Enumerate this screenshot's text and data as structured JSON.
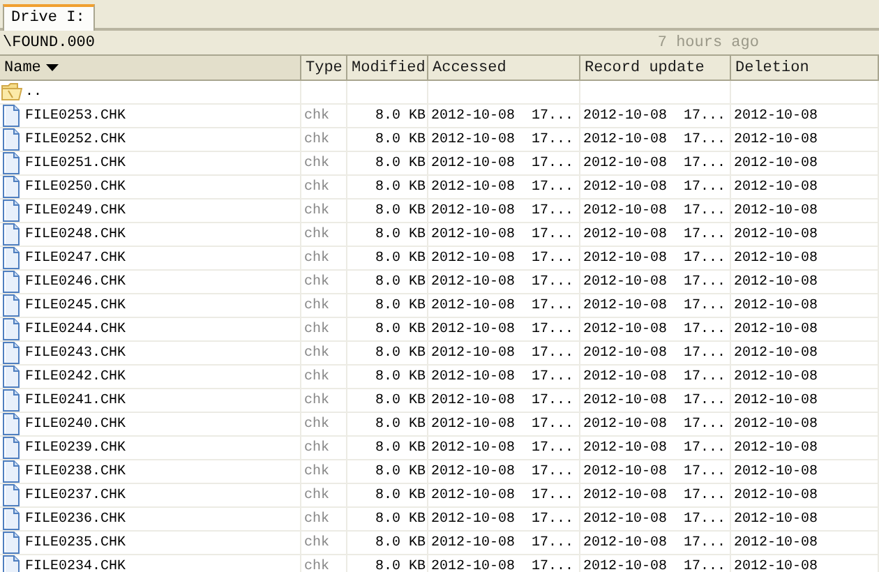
{
  "tabs": [
    {
      "label": "Drive I:",
      "selected": true
    }
  ],
  "path_bar": {
    "path": "\\FOUND.000",
    "updated": "7 hours ago"
  },
  "table": {
    "columns": [
      {
        "label": "Name",
        "sorted": true
      },
      {
        "label": "Type",
        "sorted": false
      },
      {
        "label": "Modified",
        "sorted": false
      },
      {
        "label": "Accessed",
        "sorted": false
      },
      {
        "label": "Record update",
        "sorted": false
      },
      {
        "label": "Deletion",
        "sorted": false
      }
    ],
    "rows": [
      {
        "kind": "parent",
        "name": ".."
      },
      {
        "kind": "file",
        "name": "FILE0253.CHK",
        "type": "chk",
        "modified": "8.0 KB",
        "accessed": "2012-10-08  17...",
        "record_update": "2012-10-08  17...",
        "deletion": "2012-10-08"
      },
      {
        "kind": "file",
        "name": "FILE0252.CHK",
        "type": "chk",
        "modified": "8.0 KB",
        "accessed": "2012-10-08  17...",
        "record_update": "2012-10-08  17...",
        "deletion": "2012-10-08"
      },
      {
        "kind": "file",
        "name": "FILE0251.CHK",
        "type": "chk",
        "modified": "8.0 KB",
        "accessed": "2012-10-08  17...",
        "record_update": "2012-10-08  17...",
        "deletion": "2012-10-08"
      },
      {
        "kind": "file",
        "name": "FILE0250.CHK",
        "type": "chk",
        "modified": "8.0 KB",
        "accessed": "2012-10-08  17...",
        "record_update": "2012-10-08  17...",
        "deletion": "2012-10-08"
      },
      {
        "kind": "file",
        "name": "FILE0249.CHK",
        "type": "chk",
        "modified": "8.0 KB",
        "accessed": "2012-10-08  17...",
        "record_update": "2012-10-08  17...",
        "deletion": "2012-10-08"
      },
      {
        "kind": "file",
        "name": "FILE0248.CHK",
        "type": "chk",
        "modified": "8.0 KB",
        "accessed": "2012-10-08  17...",
        "record_update": "2012-10-08  17...",
        "deletion": "2012-10-08"
      },
      {
        "kind": "file",
        "name": "FILE0247.CHK",
        "type": "chk",
        "modified": "8.0 KB",
        "accessed": "2012-10-08  17...",
        "record_update": "2012-10-08  17...",
        "deletion": "2012-10-08"
      },
      {
        "kind": "file",
        "name": "FILE0246.CHK",
        "type": "chk",
        "modified": "8.0 KB",
        "accessed": "2012-10-08  17...",
        "record_update": "2012-10-08  17...",
        "deletion": "2012-10-08"
      },
      {
        "kind": "file",
        "name": "FILE0245.CHK",
        "type": "chk",
        "modified": "8.0 KB",
        "accessed": "2012-10-08  17...",
        "record_update": "2012-10-08  17...",
        "deletion": "2012-10-08"
      },
      {
        "kind": "file",
        "name": "FILE0244.CHK",
        "type": "chk",
        "modified": "8.0 KB",
        "accessed": "2012-10-08  17...",
        "record_update": "2012-10-08  17...",
        "deletion": "2012-10-08"
      },
      {
        "kind": "file",
        "name": "FILE0243.CHK",
        "type": "chk",
        "modified": "8.0 KB",
        "accessed": "2012-10-08  17...",
        "record_update": "2012-10-08  17...",
        "deletion": "2012-10-08"
      },
      {
        "kind": "file",
        "name": "FILE0242.CHK",
        "type": "chk",
        "modified": "8.0 KB",
        "accessed": "2012-10-08  17...",
        "record_update": "2012-10-08  17...",
        "deletion": "2012-10-08"
      },
      {
        "kind": "file",
        "name": "FILE0241.CHK",
        "type": "chk",
        "modified": "8.0 KB",
        "accessed": "2012-10-08  17...",
        "record_update": "2012-10-08  17...",
        "deletion": "2012-10-08"
      },
      {
        "kind": "file",
        "name": "FILE0240.CHK",
        "type": "chk",
        "modified": "8.0 KB",
        "accessed": "2012-10-08  17...",
        "record_update": "2012-10-08  17...",
        "deletion": "2012-10-08"
      },
      {
        "kind": "file",
        "name": "FILE0239.CHK",
        "type": "chk",
        "modified": "8.0 KB",
        "accessed": "2012-10-08  17...",
        "record_update": "2012-10-08  17...",
        "deletion": "2012-10-08"
      },
      {
        "kind": "file",
        "name": "FILE0238.CHK",
        "type": "chk",
        "modified": "8.0 KB",
        "accessed": "2012-10-08  17...",
        "record_update": "2012-10-08  17...",
        "deletion": "2012-10-08"
      },
      {
        "kind": "file",
        "name": "FILE0237.CHK",
        "type": "chk",
        "modified": "8.0 KB",
        "accessed": "2012-10-08  17...",
        "record_update": "2012-10-08  17...",
        "deletion": "2012-10-08"
      },
      {
        "kind": "file",
        "name": "FILE0236.CHK",
        "type": "chk",
        "modified": "8.0 KB",
        "accessed": "2012-10-08  17...",
        "record_update": "2012-10-08  17...",
        "deletion": "2012-10-08"
      },
      {
        "kind": "file",
        "name": "FILE0235.CHK",
        "type": "chk",
        "modified": "8.0 KB",
        "accessed": "2012-10-08  17...",
        "record_update": "2012-10-08  17...",
        "deletion": "2012-10-08"
      },
      {
        "kind": "file",
        "name": "FILE0234.CHK",
        "type": "chk",
        "modified": "8.0 KB",
        "accessed": "2012-10-08  17...",
        "record_update": "2012-10-08  17...",
        "deletion": "2012-10-08"
      }
    ]
  }
}
